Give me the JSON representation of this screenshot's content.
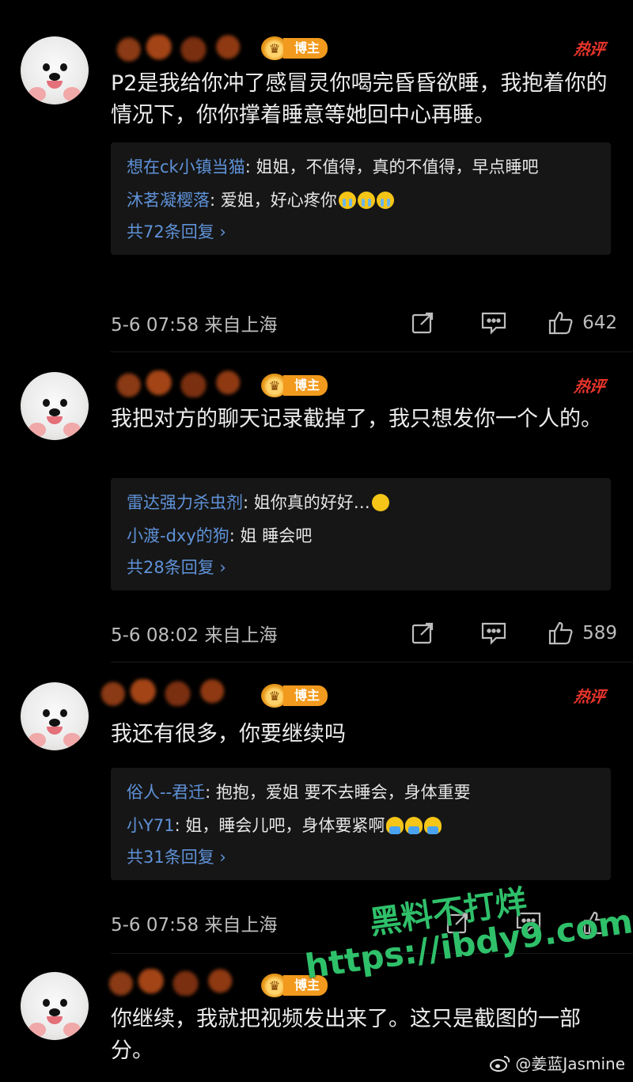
{
  "badge_label": "博主",
  "hot_label": "热评",
  "comments": [
    {
      "text": "P2是我给你冲了感冒灵你喝完昏昏欲睡，我抱着你的情况下，你你撑着睡意等她回中心再睡。",
      "replies": [
        {
          "name": "想在ck小镇当猫",
          "text": "姐姐，不值得，真的不值得，早点睡吧"
        },
        {
          "name": "沐茗凝樱落",
          "text": "爱姐，好心疼你"
        }
      ],
      "more": "共72条回复 ›",
      "time": "5-6 07:58 来自上海",
      "likes": "642"
    },
    {
      "text": "我把对方的聊天记录截掉了，我只想发你一个人的。",
      "replies": [
        {
          "name": "雷达强力杀虫剂",
          "text": "姐你真的好好…"
        },
        {
          "name": "小渡-dxy的狗",
          "text": "姐 睡会吧"
        }
      ],
      "more": "共28条回复 ›",
      "time": "5-6 08:02 来自上海",
      "likes": "589"
    },
    {
      "text": "我还有很多，你要继续吗",
      "replies": [
        {
          "name": "俗人--君迁",
          "text": "抱抱，爱姐 要不去睡会，身体重要"
        },
        {
          "name": "小Y71",
          "text": "姐，睡会儿吧，身体要紧啊"
        }
      ],
      "more": "共31条回复 ›",
      "time": "5-6 07:58 来自上海",
      "likes": ""
    },
    {
      "text": "你继续，我就把视频发出来了。这只是截图的一部分。"
    }
  ],
  "watermark": {
    "line1": "黑料不打烊",
    "line2": "https://ibdy9.com"
  },
  "credit": "@姜蓝Jasmine"
}
